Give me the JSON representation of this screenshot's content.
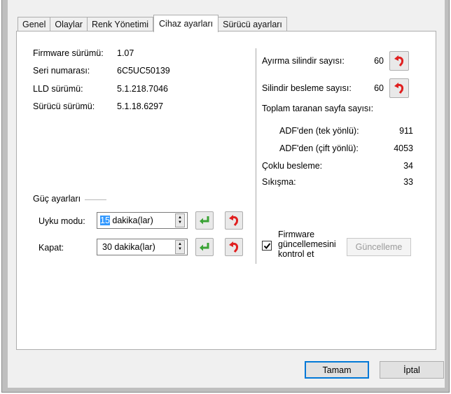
{
  "tabs": [
    {
      "label": "Genel"
    },
    {
      "label": "Olaylar"
    },
    {
      "label": "Renk Yönetimi"
    },
    {
      "label": "Cihaz ayarları"
    },
    {
      "label": "Sürücü ayarları"
    }
  ],
  "device_info": {
    "firmware_label": "Firmware sürümü:",
    "firmware_value": "1.07",
    "serial_label": "Seri numarası:",
    "serial_value": "6C5UC50139",
    "lld_label": "LLD sürümü:",
    "lld_value": "5.1.218.7046",
    "driver_label": "Sürücü sürümü:",
    "driver_value": "5.1.18.6297"
  },
  "power": {
    "group_title": "Güç ayarları",
    "sleep_label": "Uyku modu:",
    "sleep_value": "15",
    "sleep_unit": " dakika(lar)",
    "off_label": "Kapat:",
    "off_value": "30 dakika(lar)"
  },
  "counters": {
    "separation_label": "Ayırma silindir sayısı:",
    "separation_value": "60",
    "feed_label": "Silindir besleme sayısı:",
    "feed_value": "60",
    "total_label": "Toplam taranan sayfa sayısı:",
    "adf_simplex_label": "ADF'den (tek yönlü):",
    "adf_simplex_value": "911",
    "adf_duplex_label": "ADF'den (çift yönlü):",
    "adf_duplex_value": "4053",
    "multifeed_label": "Çoklu besleme:",
    "multifeed_value": "34",
    "jam_label": "Sıkışma:",
    "jam_value": "33"
  },
  "firmware_update": {
    "checkbox_label_line1": "Firmware",
    "checkbox_label_line2": "güncellemesini",
    "checkbox_label_line3": "kontrol et",
    "checked": true,
    "update_button": "Güncelleme"
  },
  "footer": {
    "ok_button": "Tamam",
    "cancel_button": "İptal"
  },
  "icons": {
    "reset": "reset-arrow-icon",
    "apply": "green-enter-arrow-icon"
  },
  "colors": {
    "reset_red": "#e02020",
    "apply_green": "#3aa335",
    "selection_blue": "#3399ff",
    "default_button_border": "#0078d7"
  }
}
